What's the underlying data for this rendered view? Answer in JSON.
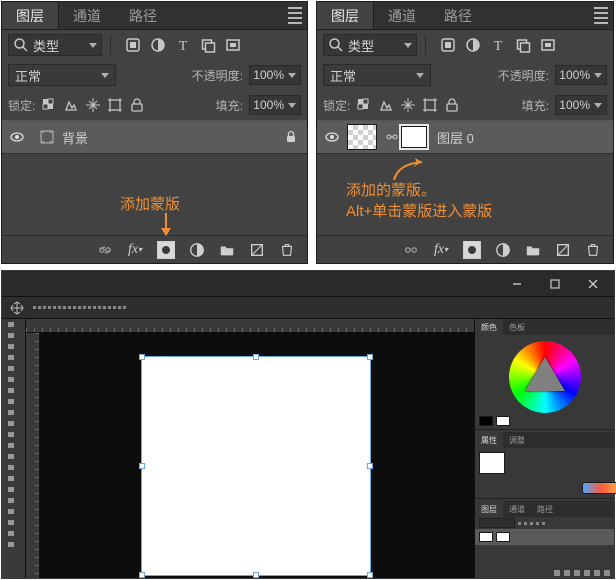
{
  "tabs": {
    "layers": "图层",
    "channels": "通道",
    "paths": "路径"
  },
  "filter": {
    "label": "类型"
  },
  "blend": {
    "mode": "正常",
    "opacityLabel": "不透明度:",
    "opacity": "100%"
  },
  "lock": {
    "label": "锁定:",
    "fillLabel": "填充:",
    "fill": "100%"
  },
  "layersLeft": [
    {
      "name": "背景",
      "locked": true,
      "selected": true
    }
  ],
  "layersRight": [
    {
      "name": "图层 0",
      "locked": false,
      "selected": true,
      "hasMask": true
    }
  ],
  "annotations": {
    "left": "添加蒙版",
    "right": "添加的蒙版。\nAlt+单击蒙版进入蒙版"
  },
  "rightPanel": {
    "tabset1": [
      "颜色",
      "色板"
    ],
    "tabset2": [
      "属性",
      "调整"
    ],
    "tabset3": [
      "图层",
      "通道",
      "路径"
    ]
  }
}
